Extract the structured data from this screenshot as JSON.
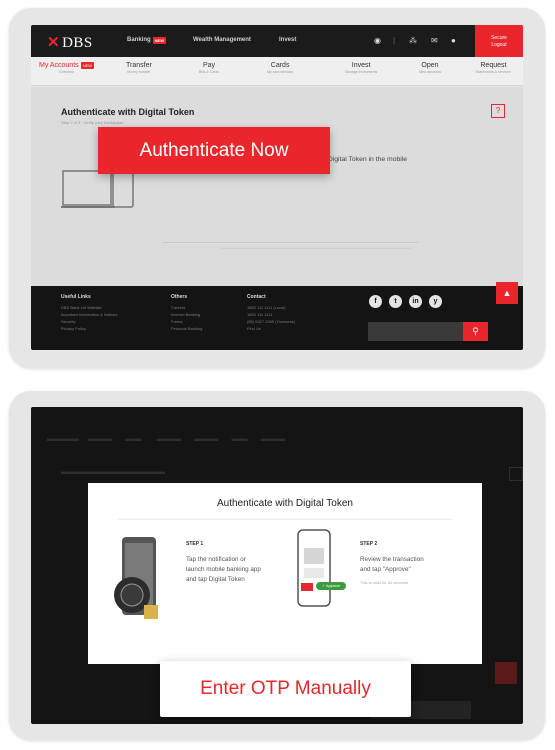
{
  "screen1": {
    "logo": "DBS",
    "topnav": [
      {
        "label": "Banking",
        "badge": "NEW"
      },
      {
        "label": "Wealth Management"
      },
      {
        "label": "Invest"
      }
    ],
    "logout": {
      "line1": "Secure",
      "line2": "Logout"
    },
    "subnav": [
      {
        "label": "My Accounts",
        "sub": "Overview",
        "badge": "NEW",
        "active": true
      },
      {
        "label": "Transfer",
        "sub": "Money transfer"
      },
      {
        "label": "Pay",
        "sub": "Bills & Cards"
      },
      {
        "label": "Cards",
        "sub": "My card services"
      },
      {
        "label": "Invest",
        "sub": "Manage investments"
      },
      {
        "label": "Open",
        "sub": "New accounts"
      },
      {
        "label": "Request",
        "sub": "Statements & services"
      }
    ],
    "auth_title": "Authenticate with Digital Token",
    "auth_sub": "Step 2 of 3 · Verify your transaction",
    "help": "?",
    "info": "You will need to authenticate this transaction with your Digital Token in the mobile banking app.",
    "info_link": "Learn more",
    "auth_button": "Authenticate Now",
    "footer": {
      "col1": {
        "head": "Useful Links",
        "lines": [
          "DBS Bank Ltd Website",
          "Important Information & Notices",
          "Security",
          "Privacy Policy"
        ]
      },
      "col2": {
        "head": "Others",
        "lines": [
          "Careers",
          "Internet Banking",
          "Forms",
          "Personal Banking"
        ]
      },
      "col3": {
        "head": "Contact",
        "lines": [
          "1800 111 1111 (Local)",
          "1800 111 1111",
          "(65) 6327 2265 (Overseas)",
          "Find Us"
        ]
      },
      "social": [
        "f",
        "t",
        "in",
        "y"
      ]
    }
  },
  "screen2": {
    "modal_title": "Authenticate with Digital Token",
    "step1": {
      "label": "STEP 1",
      "text": [
        "Tap the notification or",
        "launch mobile banking app",
        "and tap Digital Token"
      ]
    },
    "step2": {
      "label": "STEP 2",
      "text": [
        "Review the transaction",
        "and tap \"Approve\""
      ],
      "note": "This is valid for 60 seconds"
    },
    "approve_label": "✓ Approve",
    "otp_button": "Enter OTP Manually"
  },
  "colors": {
    "accent": "#e8262b",
    "dark": "#1b1b1b"
  }
}
